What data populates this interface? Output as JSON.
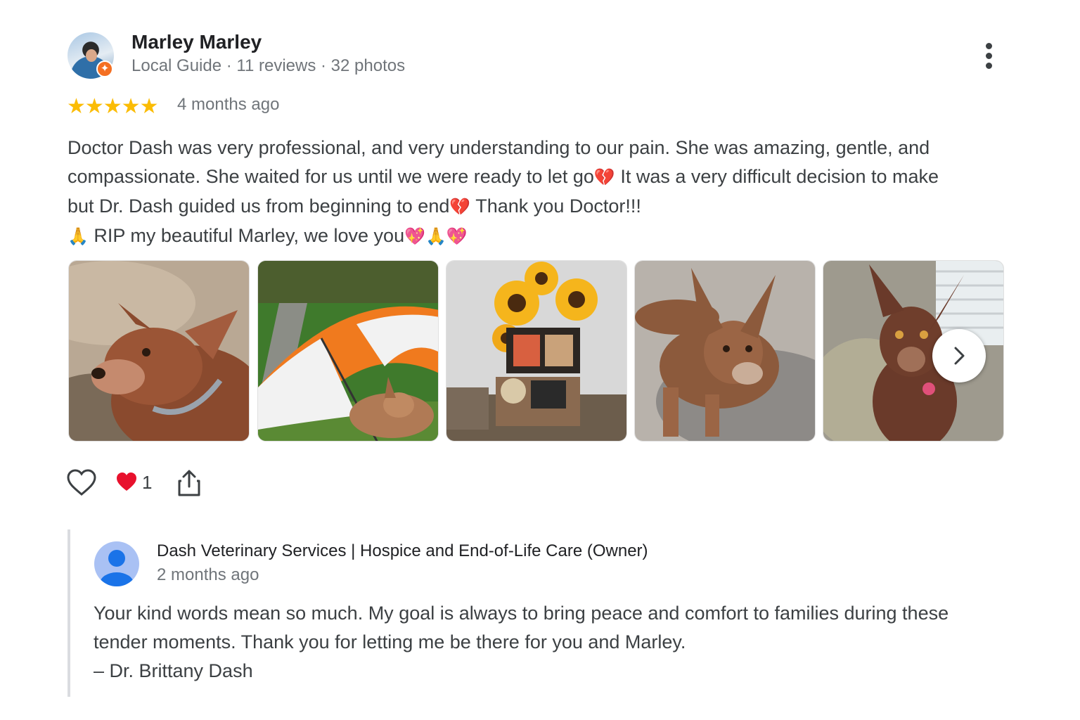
{
  "review": {
    "reviewer": {
      "name": "Marley Marley",
      "meta": "Local Guide · 11 reviews · 32 photos",
      "avatar_icon": "profile-photo",
      "badge_icon": "local-guide-badge-icon"
    },
    "rating": 5,
    "stars": "★★★★★",
    "date": "4 months ago",
    "text": {
      "line1": "Doctor Dash was very professional, and very understanding to our pain. She was amazing, gentle, and",
      "line2a": "compassionate. She waited for us until we were ready to let go",
      "line2b": " It was a very difficult decision to make",
      "line3a": "but Dr. Dash guided us from beginning to end",
      "line3b": " Thank you Doctor!!!",
      "line4": " RIP my beautiful Marley, we love you"
    },
    "emoji": {
      "broken_heart": "💔",
      "sparkling_heart": "💖",
      "praying_hands": "🙏"
    },
    "photos": [
      {
        "name": "photo-dog-on-pillow"
      },
      {
        "name": "photo-dog-under-umbrella"
      },
      {
        "name": "photo-sunflower-memorial"
      },
      {
        "name": "photo-dog-lying-on-rug"
      },
      {
        "name": "photo-dog-on-couch"
      }
    ],
    "actions": {
      "like_icon": "heart-outline-icon",
      "reaction_icon": "red-heart-icon",
      "reaction_count": "1",
      "share_icon": "share-icon"
    }
  },
  "owner_reply": {
    "name": "Dash Veterinary Services | Hospice and End-of-Life Care (Owner)",
    "date": "2 months ago",
    "avatar_icon": "default-profile-icon",
    "text": {
      "line1": "Your kind words mean so much. My goal is always to bring peace and comfort to families during these",
      "line2": "tender moments. Thank you for letting me be there for you and Marley.",
      "line3": "– Dr. Brittany Dash"
    }
  },
  "colors": {
    "star": "#fbbc04",
    "text": "#3c4043",
    "muted": "#70757a",
    "guide_badge": "#f46f22",
    "reply_bar": "#dadce0"
  }
}
